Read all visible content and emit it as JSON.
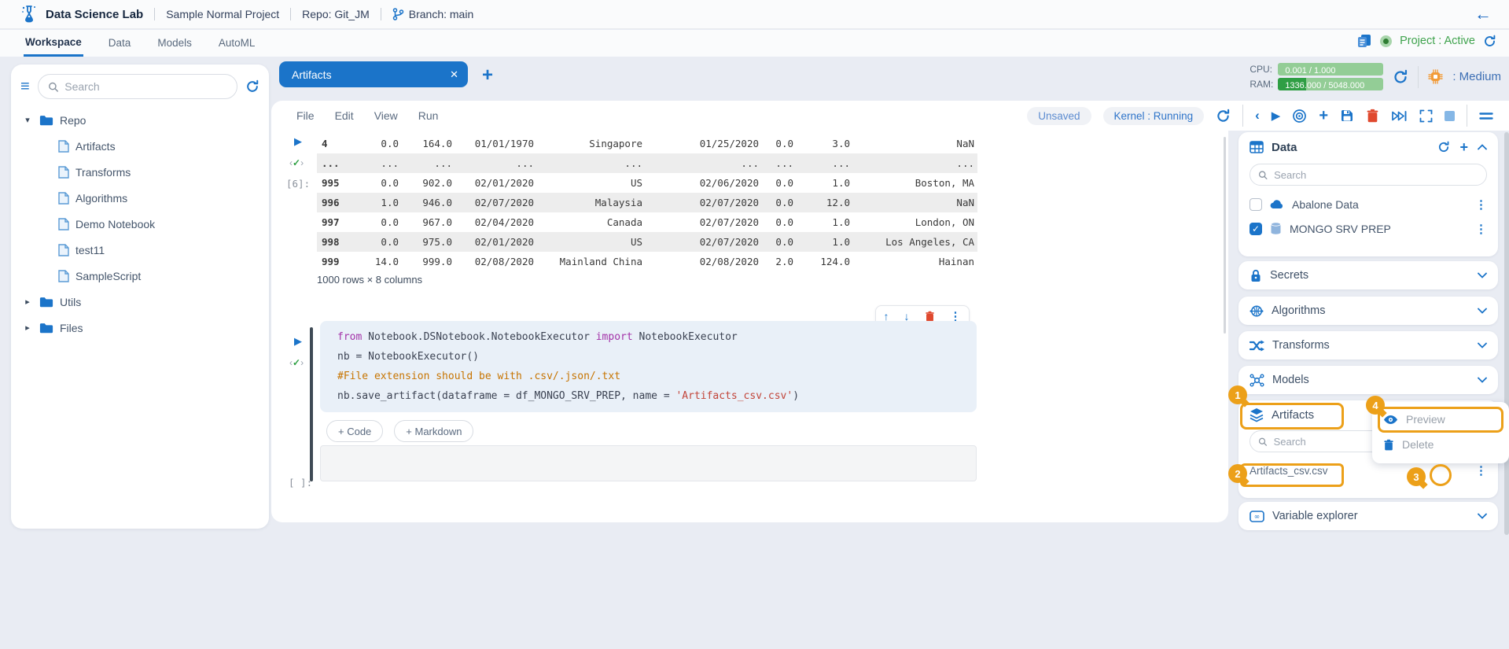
{
  "header": {
    "brand": "Data Science Lab",
    "project": "Sample Normal Project",
    "repo": "Repo: Git_JM",
    "branch": "Branch: main"
  },
  "nav": {
    "tabs": [
      "Workspace",
      "Data",
      "Models",
      "AutoML"
    ],
    "active_tab": "Workspace",
    "project_status": "Project : Active"
  },
  "resources": {
    "cpu_label": "CPU:",
    "cpu_value": "0.001 / 1.000",
    "cpu_pct": 0,
    "ram_label": "RAM:",
    "ram_value": "1336.000 / 5048.000",
    "ram_pct": 26.5,
    "instance_size": ": Medium"
  },
  "sidebar": {
    "search_placeholder": "Search",
    "tree": [
      {
        "label": "Repo",
        "type": "folder",
        "depth": 0,
        "expanded": true
      },
      {
        "label": "Artifacts",
        "type": "file",
        "depth": 1
      },
      {
        "label": "Transforms",
        "type": "file",
        "depth": 1
      },
      {
        "label": "Algorithms",
        "type": "file",
        "depth": 1
      },
      {
        "label": "Demo Notebook",
        "type": "file",
        "depth": 1
      },
      {
        "label": "test11",
        "type": "file",
        "depth": 1
      },
      {
        "label": "SampleScript",
        "type": "file",
        "depth": 1
      },
      {
        "label": "Utils",
        "type": "folder",
        "depth": 0,
        "expanded": false
      },
      {
        "label": "Files",
        "type": "folder",
        "depth": 0,
        "expanded": false
      }
    ]
  },
  "editor": {
    "tab_title": "Artifacts",
    "menus": [
      "File",
      "Edit",
      "View",
      "Run"
    ],
    "status_unsaved": "Unsaved",
    "status_kernel": "Kernel : Running"
  },
  "notebook": {
    "exec_label": "[6]:",
    "empty_exec_label": "[ ]:",
    "table": {
      "rows": [
        [
          "4",
          "0.0",
          "164.0",
          "01/01/1970",
          "Singapore",
          "01/25/2020",
          "0.0",
          "3.0",
          "NaN"
        ],
        [
          "...",
          "...",
          "...",
          "...",
          "...",
          "...",
          "...",
          "...",
          "..."
        ],
        [
          "995",
          "0.0",
          "902.0",
          "02/01/2020",
          "US",
          "02/06/2020",
          "0.0",
          "1.0",
          "Boston, MA"
        ],
        [
          "996",
          "1.0",
          "946.0",
          "02/07/2020",
          "Malaysia",
          "02/07/2020",
          "0.0",
          "12.0",
          "NaN"
        ],
        [
          "997",
          "0.0",
          "967.0",
          "02/04/2020",
          "Canada",
          "02/07/2020",
          "0.0",
          "1.0",
          "London, ON"
        ],
        [
          "998",
          "0.0",
          "975.0",
          "02/01/2020",
          "US",
          "02/07/2020",
          "0.0",
          "1.0",
          "Los Angeles, CA"
        ],
        [
          "999",
          "14.0",
          "999.0",
          "02/08/2020",
          "Mainland China",
          "02/08/2020",
          "2.0",
          "124.0",
          "Hainan"
        ]
      ],
      "summary": "1000 rows × 8 columns"
    },
    "code_lines": [
      {
        "tokens": [
          {
            "t": "from ",
            "c": "kw"
          },
          {
            "t": "Notebook.DSNotebook.NotebookExecutor ",
            "c": "plain"
          },
          {
            "t": "import ",
            "c": "kw"
          },
          {
            "t": "NotebookExecutor",
            "c": "plain"
          }
        ]
      },
      {
        "tokens": [
          {
            "t": "nb = NotebookExecutor()",
            "c": "plain"
          }
        ]
      },
      {
        "tokens": [
          {
            "t": "#File extension should be with .csv/.json/.txt",
            "c": "comment"
          }
        ]
      },
      {
        "tokens": [
          {
            "t": "nb.save_artifact(dataframe = df_MONGO_SRV_PREP, name = ",
            "c": "plain"
          },
          {
            "t": "'Artifacts_csv.csv'",
            "c": "str"
          },
          {
            "t": ")",
            "c": "plain"
          }
        ]
      }
    ],
    "add_code_label": "+ Code",
    "add_markdown_label": "+ Markdown"
  },
  "right_panel": {
    "data_section": {
      "title": "Data",
      "search_placeholder": "Search",
      "items": [
        {
          "name": "Abalone Data",
          "checked": false,
          "icon": "cloud"
        },
        {
          "name": "MONGO SRV PREP",
          "checked": true,
          "icon": "database"
        }
      ]
    },
    "sections": [
      {
        "label": "Secrets",
        "icon": "lock"
      },
      {
        "label": "Algorithms",
        "icon": "algorithms"
      },
      {
        "label": "Transforms",
        "icon": "transforms"
      },
      {
        "label": "Models",
        "icon": "models"
      }
    ],
    "artifacts_section": {
      "title": "Artifacts",
      "search_placeholder": "Search",
      "file_name": "Artifacts_csv.csv"
    },
    "context_menu": {
      "preview_label": "Preview",
      "delete_label": "Delete"
    },
    "variable_explorer_label": "Variable explorer"
  },
  "annotations": [
    "1",
    "2",
    "3",
    "4"
  ],
  "colors": {
    "accent": "#1B74C9",
    "annotation": "#ECA019",
    "success": "#3FA34D",
    "danger": "#E0492E"
  }
}
